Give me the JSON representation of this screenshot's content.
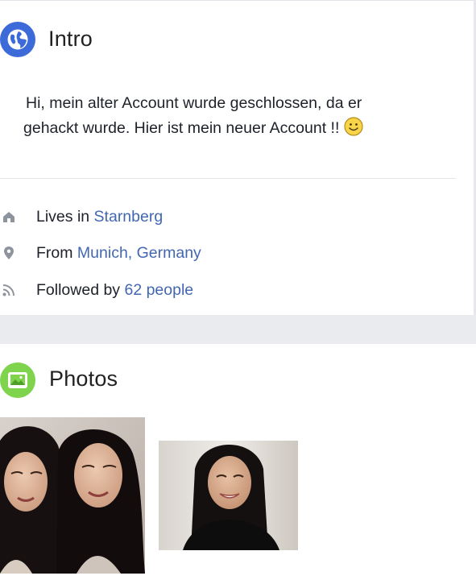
{
  "intro": {
    "title": "Intro",
    "icon": "globe-icon",
    "bio_line1": "Hi, mein alter Account wurde geschlossen, da er",
    "bio_line2": "gehackt wurde. Hier ist mein neuer Account !!",
    "bio_emoji": "smiley-icon",
    "details": [
      {
        "icon": "home-icon",
        "prefix": "Lives in",
        "link": "Starnberg"
      },
      {
        "icon": "location-pin-icon",
        "prefix": "From",
        "link": "Munich, Germany"
      },
      {
        "icon": "rss-follow-icon",
        "prefix": "Followed by",
        "link": "62 people"
      }
    ]
  },
  "photos": {
    "title": "Photos",
    "icon": "picture-icon",
    "items": [
      {
        "name": "photo-two-women-selfie"
      },
      {
        "name": "photo-woman-portrait"
      }
    ]
  },
  "colors": {
    "link": "#4267b2",
    "intro_icon_bg": "#3c6bd9",
    "photos_icon_bg": "#7fd34d",
    "page_gap": "#e9ebee"
  }
}
